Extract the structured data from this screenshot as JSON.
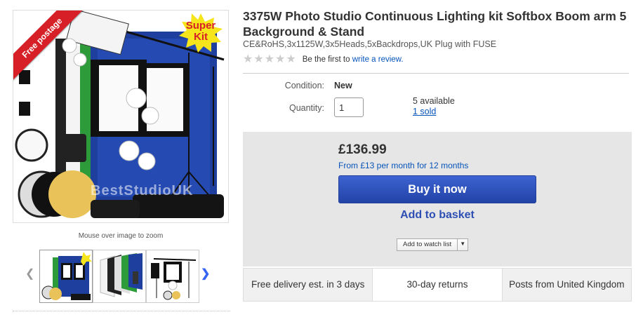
{
  "gallery": {
    "ribbon_text": "Free postage",
    "badge_line1": "Super",
    "badge_line2": "Kit",
    "watermark": "BestStudioUK",
    "zoom_hint": "Mouse over image to zoom",
    "thumbnails": [
      "main kit",
      "backdrops",
      "softbox set"
    ]
  },
  "item": {
    "title": "3375W Photo Studio Continuous Lighting kit Softbox Boom arm 5 Background & Stand",
    "subtitle": "CE&RoHS,3x1125W,3x5Heads,5xBackdrops,UK Plug with FUSE",
    "rating_stars": 0,
    "rating_prefix": "Be the first to",
    "rating_link": "write a review."
  },
  "details": {
    "condition_label": "Condition:",
    "condition_value": "New",
    "quantity_label": "Quantity:",
    "quantity_value": "1",
    "available": "5 available",
    "sold": "1 sold"
  },
  "buy": {
    "price": "£136.99",
    "finance": "From £13 per month for 12 months",
    "buy_now": "Buy it now",
    "add_to_basket": "Add to basket",
    "watch_list": "Add to watch list"
  },
  "features": [
    "Free delivery est. in 3 days",
    "30-day returns",
    "Posts from United Kingdom"
  ],
  "colors": {
    "link": "#0654ba",
    "buy_button": "#2d4fb4",
    "ribbon": "#d61f26",
    "badge_star": "#f5e51a"
  }
}
